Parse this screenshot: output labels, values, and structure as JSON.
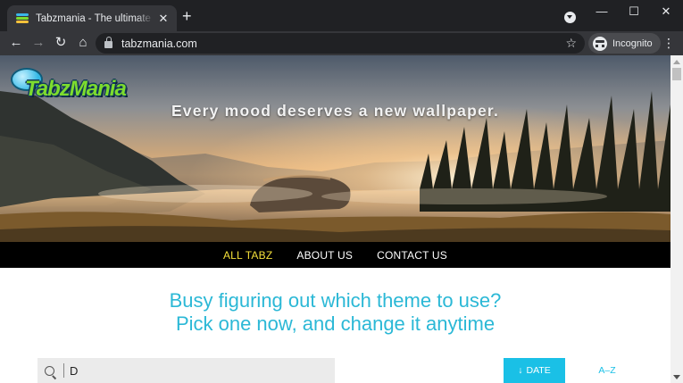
{
  "browser": {
    "tab_title": "Tabzmania - The ultimate new tab",
    "tab_close": "✕",
    "new_tab": "+",
    "url": "tabzmania.com",
    "incognito_label": "Incognito",
    "nav": {
      "back": "←",
      "forward": "→",
      "reload": "↻",
      "home": "⌂",
      "star": "☆",
      "menu": "⋮"
    },
    "window_controls": {
      "minimize": "—",
      "maximize": "☐",
      "close": "✕"
    }
  },
  "site": {
    "logo_text": "TabzMania",
    "hero_tagline": "Every mood deserves a new wallpaper.",
    "nav_items": [
      {
        "label": "ALL TABZ",
        "active": true
      },
      {
        "label": "ABOUT US",
        "active": false
      },
      {
        "label": "CONTACT US",
        "active": false
      }
    ],
    "headline_line1": "Busy figuring out which theme to use?",
    "headline_line2": "Pick one now, and change it anytime",
    "search": {
      "value": "D",
      "placeholder": ""
    },
    "sort_date_label": "DATE",
    "sort_date_arrow": "↓",
    "sort_az_label": "A–Z"
  },
  "colors": {
    "accent": "#1ac0e6",
    "headline": "#2bb8d6",
    "nav_active": "#f4e03a",
    "chrome_dark": "#202124",
    "chrome_toolbar": "#35363a"
  },
  "icons": [
    "favicon-icon",
    "close-icon",
    "plus-icon",
    "tab-search-icon",
    "back-icon",
    "forward-icon",
    "reload-icon",
    "home-icon",
    "lock-icon",
    "star-icon",
    "incognito-icon",
    "kebab-menu-icon",
    "search-icon",
    "arrow-down-icon"
  ]
}
